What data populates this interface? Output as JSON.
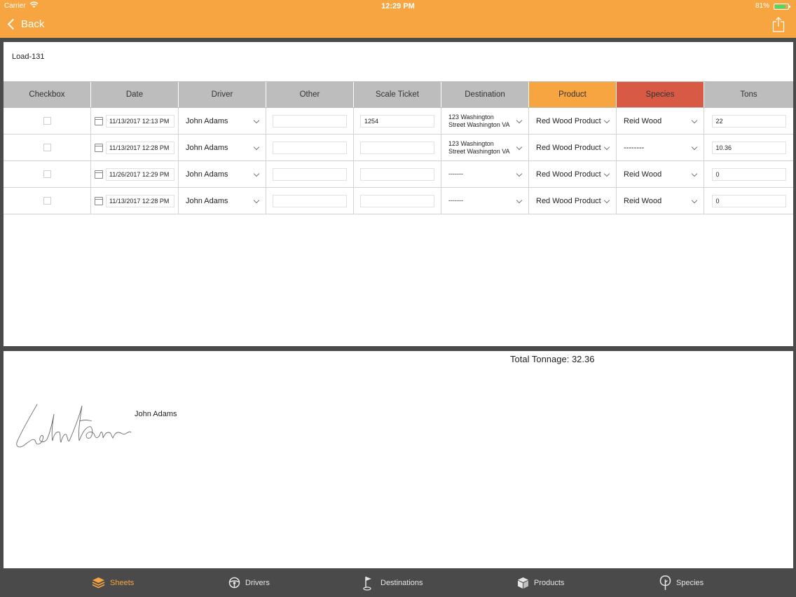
{
  "status_bar": {
    "carrier": "Carrier",
    "time": "12:29 PM",
    "battery": "81%",
    "battery_level": 0.81
  },
  "nav": {
    "back_label": "Back",
    "share_icon": "share-icon"
  },
  "sheet": {
    "title": "Load-131"
  },
  "table": {
    "columns": [
      "Checkbox",
      "Date",
      "Driver",
      "Other",
      "Scale Ticket",
      "Destination",
      "Product",
      "Species",
      "Tons"
    ],
    "header_colors": {
      "default": "#bdbdbd",
      "Product": "#f7a541",
      "Species": "#d85a45"
    },
    "rows": [
      {
        "checked": false,
        "date": "11/13/2017 12:13 PM",
        "driver": "John Adams",
        "other": "",
        "scale_ticket": "1254",
        "destination_line1": "123 Washington",
        "destination_line2": "Street Washington VA",
        "product": "Red Wood Product",
        "species": "Reid Wood",
        "tons": "22"
      },
      {
        "checked": false,
        "date": "11/13/2017 12:28 PM",
        "driver": "John Adams",
        "other": "",
        "scale_ticket": "",
        "destination_line1": "123 Washington",
        "destination_line2": "Street Washington VA",
        "product": "Red Wood Product",
        "species": "--------",
        "tons": "10.36"
      },
      {
        "checked": false,
        "date": "11/26/2017 12:29 PM",
        "driver": "John Adams",
        "other": "",
        "scale_ticket": "",
        "destination_line1": "-------",
        "destination_line2": "",
        "product": "Red Wood Product",
        "species": "Reid Wood",
        "tons": "0"
      },
      {
        "checked": false,
        "date": "11/13/2017 12:28 PM",
        "driver": "John Adams",
        "other": "",
        "scale_ticket": "",
        "destination_line1": "-------",
        "destination_line2": "",
        "product": "Red Wood Product",
        "species": "Reid Wood",
        "tons": "0"
      }
    ]
  },
  "summary": {
    "total_tonnage": "Total Tonnage: 32.36"
  },
  "signature": {
    "name": "John Adams"
  },
  "tabbar": {
    "tabs": [
      {
        "label": "Sheets",
        "icon": "layers-icon",
        "active": true
      },
      {
        "label": "Drivers",
        "icon": "steering-wheel-icon",
        "active": false
      },
      {
        "label": "Destinations",
        "icon": "flag-icon",
        "active": false
      },
      {
        "label": "Products",
        "icon": "box-icon",
        "active": false
      },
      {
        "label": "Species",
        "icon": "tree-icon",
        "active": false
      }
    ]
  },
  "colors": {
    "accent": "#f7a541",
    "species_header": "#d85a45",
    "tabbar_bg": "#4a4a4a"
  }
}
